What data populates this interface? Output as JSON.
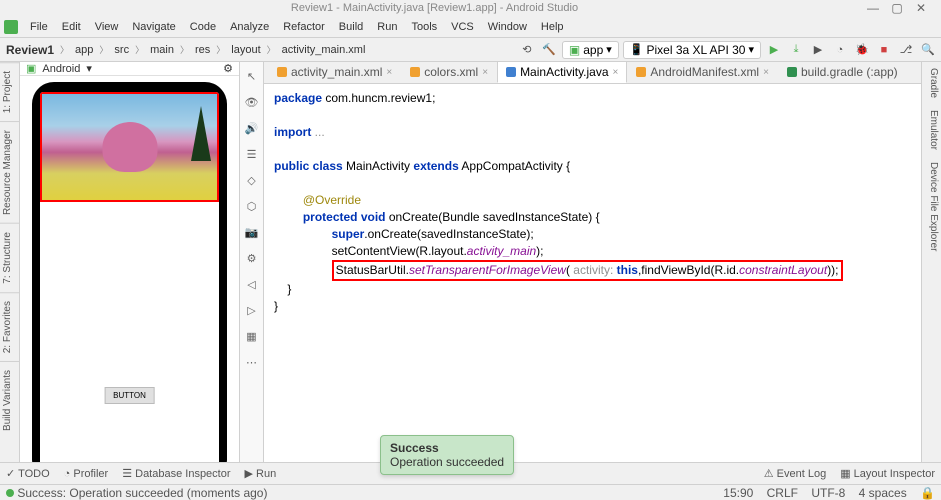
{
  "title": "Review1 - MainActivity.java [Review1.app] - Android Studio",
  "menu": [
    "File",
    "Edit",
    "View",
    "Navigate",
    "Code",
    "Analyze",
    "Refactor",
    "Build",
    "Run",
    "Tools",
    "VCS",
    "Window",
    "Help"
  ],
  "breadcrumb": [
    "Review1",
    "app",
    "src",
    "main",
    "res",
    "layout",
    "activity_main.xml"
  ],
  "run_config": "app",
  "device": "Pixel 3a XL API 30",
  "left_tabs": [
    "1: Project",
    "Resource Manager",
    "7: Structure",
    "2: Favorites",
    "Build Variants"
  ],
  "right_tabs": [
    "Gradle",
    "Emulator",
    "Device File Explorer"
  ],
  "preview_header": "Android",
  "phone_button": "BUTTON",
  "editor_tabs": [
    {
      "label": "activity_main.xml",
      "active": false
    },
    {
      "label": "colors.xml",
      "active": false
    },
    {
      "label": "MainActivity.java",
      "active": true
    },
    {
      "label": "AndroidManifest.xml",
      "active": false
    },
    {
      "label": "build.gradle (:app)",
      "active": false
    }
  ],
  "code": {
    "l1a": "package",
    "l1b": " com.huncm.review1;",
    "l2a": "import",
    "l2b": " ...",
    "l3a": "public class",
    "l3b": " MainActivity ",
    "l3c": "extends",
    "l3d": " AppCompatActivity {",
    "l4": "@Override",
    "l5a": "protected void",
    "l5b": " onCreate(Bundle savedInstanceState) {",
    "l6a": "super",
    "l6b": ".onCreate(savedInstanceState);",
    "l7a": "setContentView(R.layout.",
    "l7b": "activity_main",
    "l7c": ");",
    "l8a": "StatusBarUtil.",
    "l8b": "setTransparentForImageView",
    "l8c": "( ",
    "l8d": "activity:",
    "l8e": " this",
    "l8f": ",findViewById(R.id.",
    "l8g": "constraintLayout",
    "l8h": "));",
    "l9": "    }",
    "l10": "}"
  },
  "notification": {
    "title": "Success",
    "body": "Operation succeeded"
  },
  "bottom_tools": [
    "TODO",
    "Profiler",
    "Database Inspector",
    "Run"
  ],
  "bottom_right": [
    "Event Log",
    "Layout Inspector"
  ],
  "status_left": "Success: Operation succeeded (moments ago)",
  "status_right": {
    "pos": "15:90",
    "eol": "CRLF",
    "enc": "UTF-8",
    "indent": "4 spaces"
  }
}
